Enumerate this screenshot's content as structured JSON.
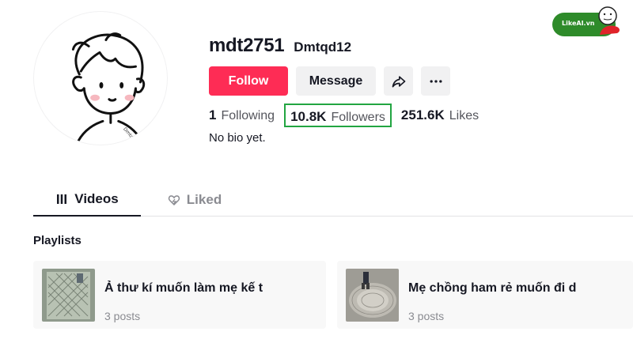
{
  "profile": {
    "username": "mdt2751",
    "nickname": "Dmtqd12",
    "bio": "No bio yet."
  },
  "actions": {
    "follow_label": "Follow",
    "message_label": "Message"
  },
  "stats": {
    "following_count": "1",
    "following_label": "Following",
    "followers_count": "10.8K",
    "followers_label": "Followers",
    "likes_count": "251.6K",
    "likes_label": "Likes"
  },
  "tabs": [
    {
      "label": "Videos",
      "icon": "grid-icon",
      "active": true
    },
    {
      "label": "Liked",
      "icon": "heart-outline-icon",
      "active": false
    }
  ],
  "playlists": {
    "title": "Playlists",
    "items": [
      {
        "name": "Ả thư kí muốn làm mẹ kế t",
        "count": "3 posts"
      },
      {
        "name": "Mẹ chồng ham rẻ muốn đi d",
        "count": "3 posts"
      }
    ]
  },
  "watermark": {
    "text": "LikeAI.vn"
  },
  "colors": {
    "follow_button": "#fe2c55",
    "followers_highlight": "#22a541",
    "secondary_button": "#f1f1f2"
  }
}
